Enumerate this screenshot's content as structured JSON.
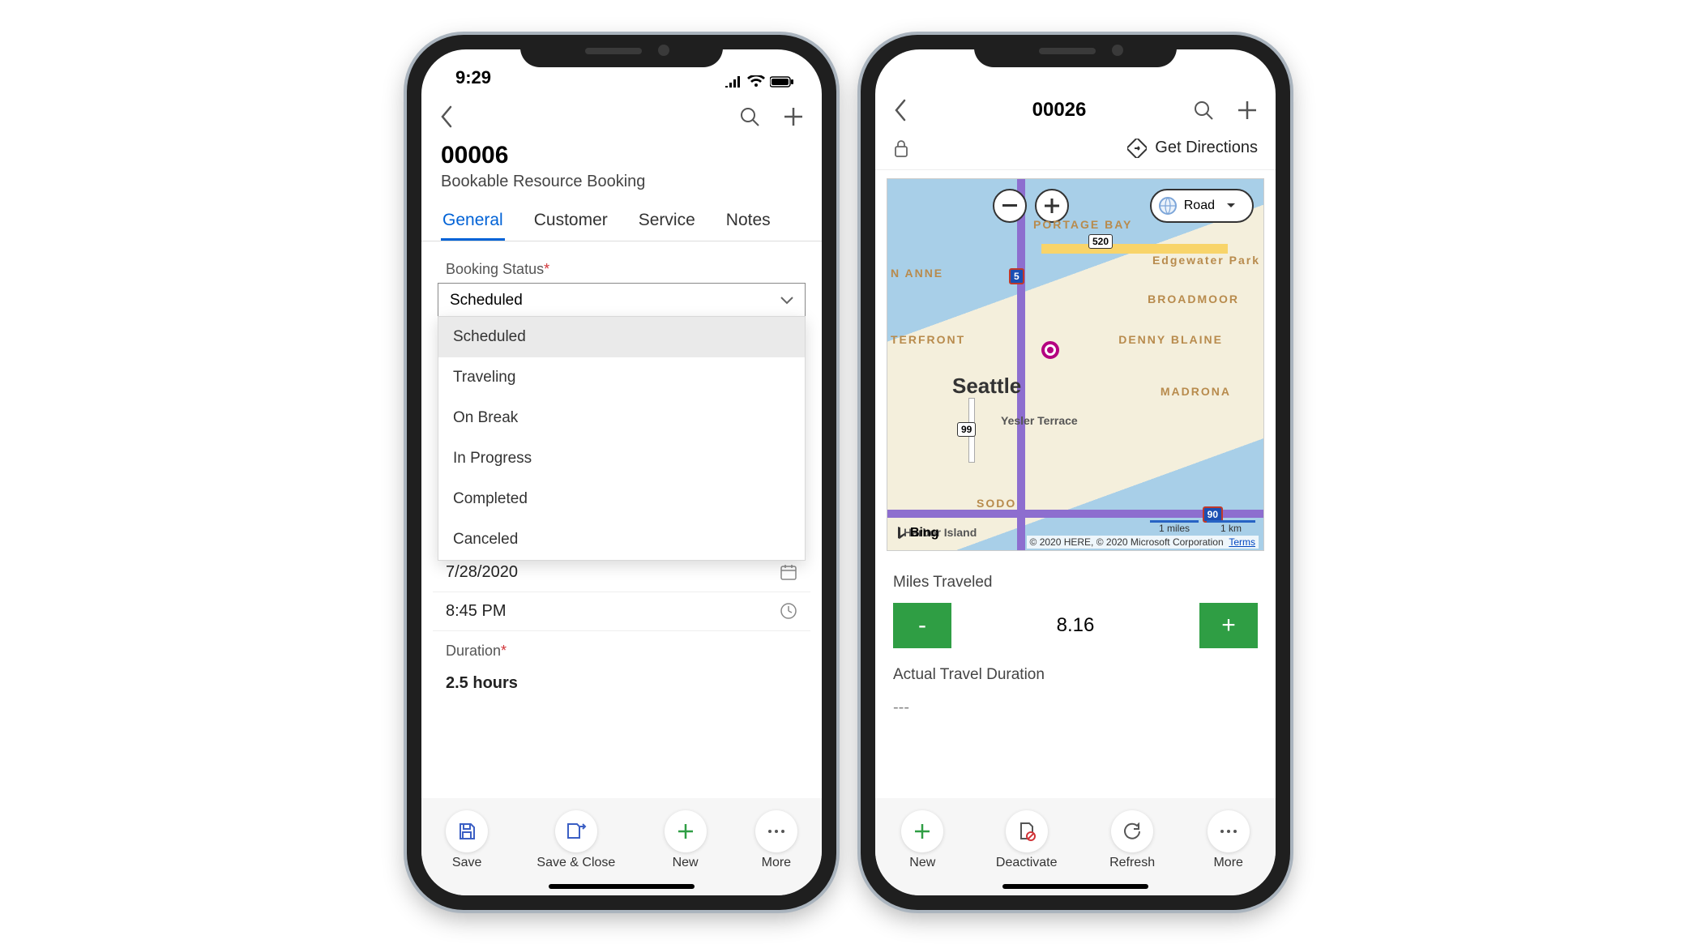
{
  "phone1": {
    "statusbar_time": "9:29",
    "booking_id": "00006",
    "booking_subtitle": "Bookable Resource Booking",
    "tabs": [
      "General",
      "Customer",
      "Service",
      "Notes"
    ],
    "active_tab_index": 0,
    "status_field_label": "Booking Status",
    "status_selected": "Scheduled",
    "status_options": [
      "Scheduled",
      "Traveling",
      "On Break",
      "In Progress",
      "Completed",
      "Canceled"
    ],
    "date_value": "7/28/2020",
    "time_value": "8:45 PM",
    "duration_label": "Duration",
    "duration_value": "2.5 hours",
    "bottom_actions": [
      {
        "label": "Save",
        "icon": "save-icon"
      },
      {
        "label": "Save & Close",
        "icon": "save-close-icon"
      },
      {
        "label": "New",
        "icon": "plus-icon"
      },
      {
        "label": "More",
        "icon": "more-icon"
      }
    ]
  },
  "phone2": {
    "header_title": "00026",
    "get_directions_label": "Get Directions",
    "map": {
      "mode": "Road",
      "city": "Seattle",
      "neighborhoods": [
        "PORTAGE BAY",
        "Edgewater Park",
        "BROADMOOR",
        "DENNY BLAINE",
        "MADRONA",
        "Yesler Terrace",
        "SODO",
        "TERFRONT",
        "N ANNE",
        "Harbor Island"
      ],
      "highways": [
        "520",
        "5",
        "99",
        "90"
      ],
      "credit_prefix": "© 2020 HERE, © 2020 Microsoft Corporation",
      "credit_link": "Terms",
      "scale_mi": "1 miles",
      "scale_km": "1 km",
      "bing_label": "Bing"
    },
    "miles_label": "Miles Traveled",
    "miles_value": "8.16",
    "actual_travel_label": "Actual Travel Duration",
    "actual_travel_value": "---",
    "bottom_actions": [
      {
        "label": "New",
        "icon": "plus-icon"
      },
      {
        "label": "Deactivate",
        "icon": "deactivate-icon"
      },
      {
        "label": "Refresh",
        "icon": "refresh-icon"
      },
      {
        "label": "More",
        "icon": "more-icon"
      }
    ]
  }
}
